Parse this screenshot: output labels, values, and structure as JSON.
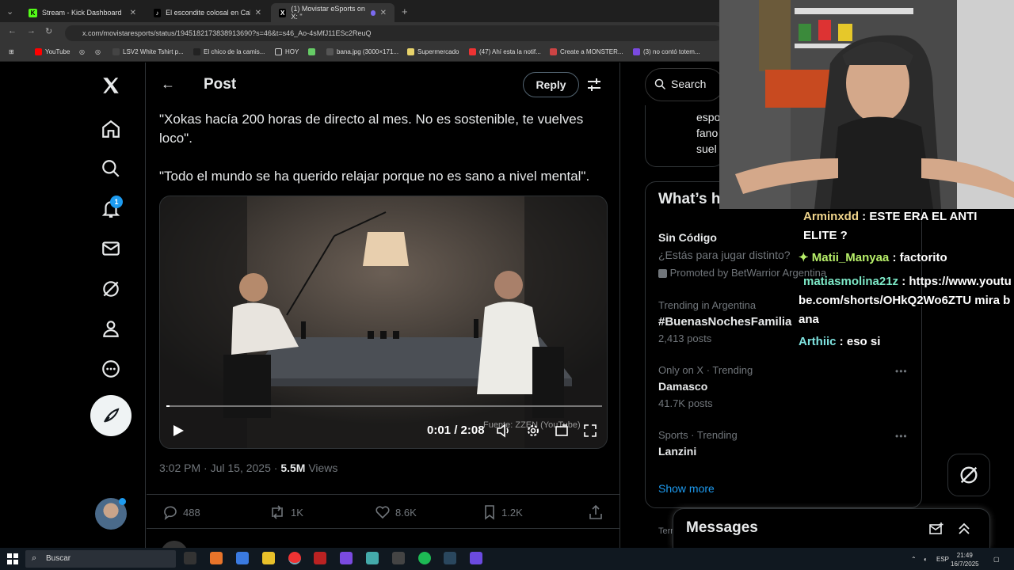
{
  "browser": {
    "tabs": [
      {
        "label": "Stream - Kick Dashboard",
        "favicon": "K"
      },
      {
        "label": "El escondite colosal en Call of D",
        "favicon": "♪"
      },
      {
        "label": "(1) Movistar eSports on X: \"",
        "favicon": "X"
      }
    ],
    "new_tab": "+",
    "url": "x.com/movistaresports/status/1945182173838913690?s=46&t=s46_Ao-4sMfJ11ESc2ReuQ",
    "bookmarks": [
      "YouTube",
      "LSV2 White Tshirt p...",
      "El chico de la camis...",
      "HOY",
      "bana.jpg (3000×171...",
      "Supermercado",
      "(47) Ahí esta la notif...",
      "Create a MONSTER...",
      "(3) no contó totem..."
    ]
  },
  "nav": {
    "notification_count": "1"
  },
  "post": {
    "title": "Post",
    "reply_label": "Reply",
    "quote1": "\"Xokas hacía 200 horas de directo al mes. No es sostenible, te vuelves loco\".",
    "quote2": "\"Todo el mundo se ha querido relajar porque no es sano a nivel mental\".",
    "video_time": "0:01 / 2:08",
    "video_source": "Fuente: ZZEN (YouTube)",
    "video_progress": 0.008,
    "time": "3:02 PM · Jul 15, 2025 · ",
    "views_count": "5.5M",
    "views_label": " Views",
    "replies": "488",
    "reposts": "1K",
    "likes": "8.6K",
    "bookmarks": "1.2K"
  },
  "sidebar": {
    "search_label": "Search",
    "peek_lines": [
      "espo",
      "fano",
      "suel"
    ],
    "whats_happening": "What’s happening",
    "trends": [
      {
        "title": "Sin Código",
        "sub": "¿Estás para jugar distinto?",
        "promo": "Promoted by BetWarrior Argentina"
      },
      {
        "context": "Trending in Argentina",
        "title": "#BuenasNochesFamilia",
        "posts": "2,413 posts"
      },
      {
        "context": "Only on X · Trending",
        "title": "Damasco",
        "posts": "41.7K posts"
      },
      {
        "context": "Sports · Trending",
        "title": "Lanzini"
      }
    ],
    "more_glyph": "•••",
    "show_more": "Show more",
    "terms": "Terms",
    "messages_label": "Messages"
  },
  "chat": [
    {
      "user": "Arminxdd",
      "text": " : ESTE ERA EL ANTI ELITE ? "
    },
    {
      "user": "✦ Matii_Manyaa",
      "text": " : factorito"
    },
    {
      "user": "matiasmolina21z",
      "text": " : https://www.youtube.com/shorts/OHkQ2Wo6ZTU mira bana"
    },
    {
      "user": "Arthiic",
      "text": " : eso si"
    }
  ],
  "taskbar": {
    "search_label": "Buscar",
    "lang": "ESP",
    "time": "21:49",
    "date": "16/7/2025"
  }
}
